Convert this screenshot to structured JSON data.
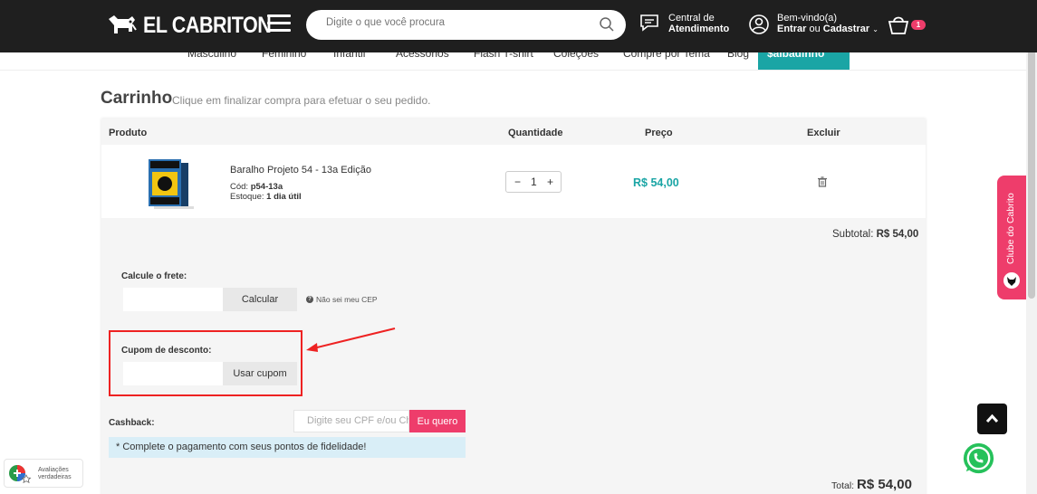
{
  "header": {
    "brand": "EL CABRITON",
    "search_placeholder": "Digite o que você procura",
    "support_line1": "Central de",
    "support_line2": "Atendimento",
    "account_line1": "Bem-vindo(a)",
    "account_enter": "Entrar",
    "account_or": "ou",
    "account_register": "Cadastrar",
    "cart_count": "1"
  },
  "nav": {
    "items": [
      "Masculino",
      "Feminino",
      "Infantil",
      "Acessórios",
      "Flash T-shirt",
      "Coleções",
      "Compre por Tema",
      "Blog"
    ],
    "active": "$albadinho"
  },
  "page": {
    "title": "Carrinho",
    "subtitle": "Clique em finalizar compra para efetuar o seu pedido."
  },
  "table": {
    "headers": {
      "product": "Produto",
      "quantity": "Quantidade",
      "price": "Preço",
      "remove": "Excluir"
    },
    "item": {
      "name": "Baralho Projeto 54 - 13a Edição",
      "code_label": "Cód:",
      "code": "p54-13a",
      "stock_label": "Estoque:",
      "stock": "1 dia útil",
      "qty": "1",
      "price": "R$ 54,00"
    }
  },
  "summary": {
    "subtotal_label": "Subtotal:",
    "subtotal_value": "R$ 54,00",
    "total_label": "Total:",
    "total_value": "R$ 54,00"
  },
  "shipping": {
    "label": "Calcule o frete:",
    "button": "Calcular",
    "help": "Não sei meu CEP"
  },
  "coupon": {
    "label": "Cupom de desconto:",
    "button": "Usar cupom"
  },
  "cashback": {
    "label": "Cashback:",
    "placeholder": "Digite seu CPF e/ou Ch",
    "button": "Eu quero",
    "info": "* Complete o pagamento com seus pontos de fidelidade!"
  },
  "widgets": {
    "clube": "Clube do Cabrito",
    "reviews_line1": "Avaliações",
    "reviews_line2": "verdadeiras"
  },
  "colors": {
    "accent_teal": "#1aa5a5",
    "accent_pink": "#ee3d6b",
    "header_bg": "#1f1f1f",
    "highlight_red": "#e22222"
  }
}
